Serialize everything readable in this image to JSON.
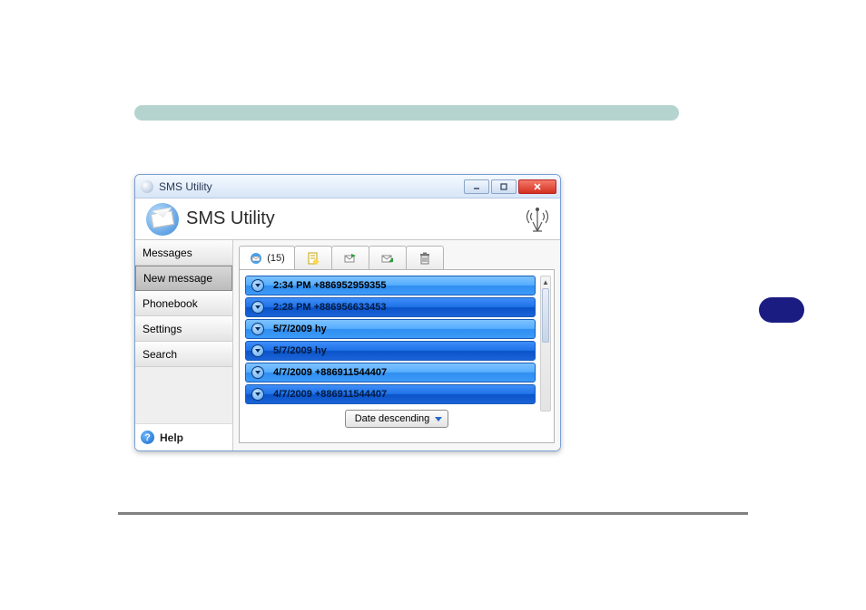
{
  "titlebar": {
    "title": "SMS Utility"
  },
  "banner": {
    "heading": "SMS Utility"
  },
  "sidebar": {
    "items": [
      {
        "label": "Messages"
      },
      {
        "label": "New message"
      },
      {
        "label": "Phonebook"
      },
      {
        "label": "Settings"
      },
      {
        "label": "Search"
      }
    ],
    "help": "Help"
  },
  "tabs": {
    "inbox_count": "(15)"
  },
  "messages": [
    {
      "text": "2:34 PM  +886952959355",
      "shade": "light"
    },
    {
      "text": "2:28 PM  +886956633453",
      "shade": "dark"
    },
    {
      "text": "5/7/2009  hy",
      "shade": "light"
    },
    {
      "text": "5/7/2009  hy",
      "shade": "dark"
    },
    {
      "text": "4/7/2009  +886911544407",
      "shade": "light"
    },
    {
      "text": "4/7/2009  +886911544407",
      "shade": "dark"
    }
  ],
  "sort": {
    "label": "Date descending"
  }
}
